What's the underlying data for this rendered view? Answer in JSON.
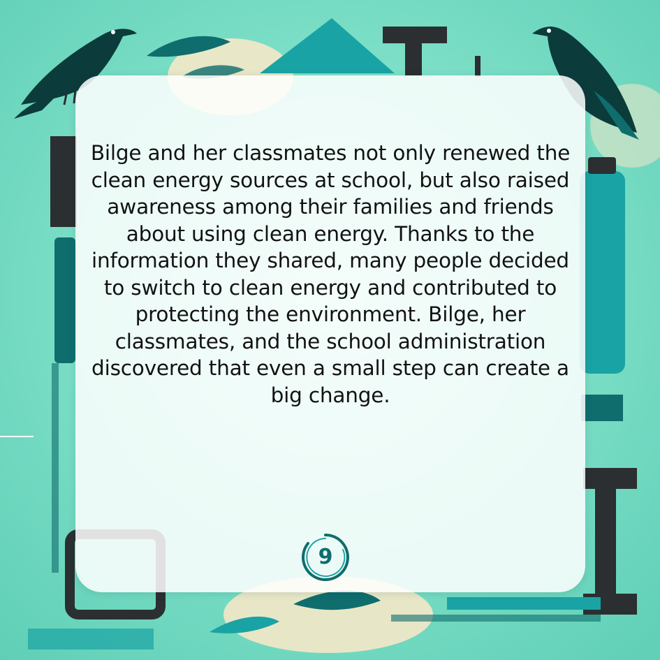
{
  "story": {
    "text": "Bilge and her classmates not only renewed the clean energy sources at school, but also raised awareness among their families and friends about using clean energy. Thanks to the information they shared, many people decided to switch to clean energy and contributed to protecting the environment. Bilge, her classmates, and the school administration discovered that even a small step can create a big change."
  },
  "page": {
    "number": "9"
  },
  "colors": {
    "background": "#7fe0c8",
    "teal_dark": "#0f6d6e",
    "teal_mid": "#1aa3a4",
    "bird": "#0c3b3c",
    "charcoal": "#2b2f31",
    "cream": "#f4e8c8"
  },
  "decorations": {
    "icons": [
      "crow-left-icon",
      "crow-right-icon",
      "teal-triangle-icon",
      "letter-t-icon",
      "bottle-icon",
      "book-stack-icon",
      "leaf-icon"
    ]
  }
}
